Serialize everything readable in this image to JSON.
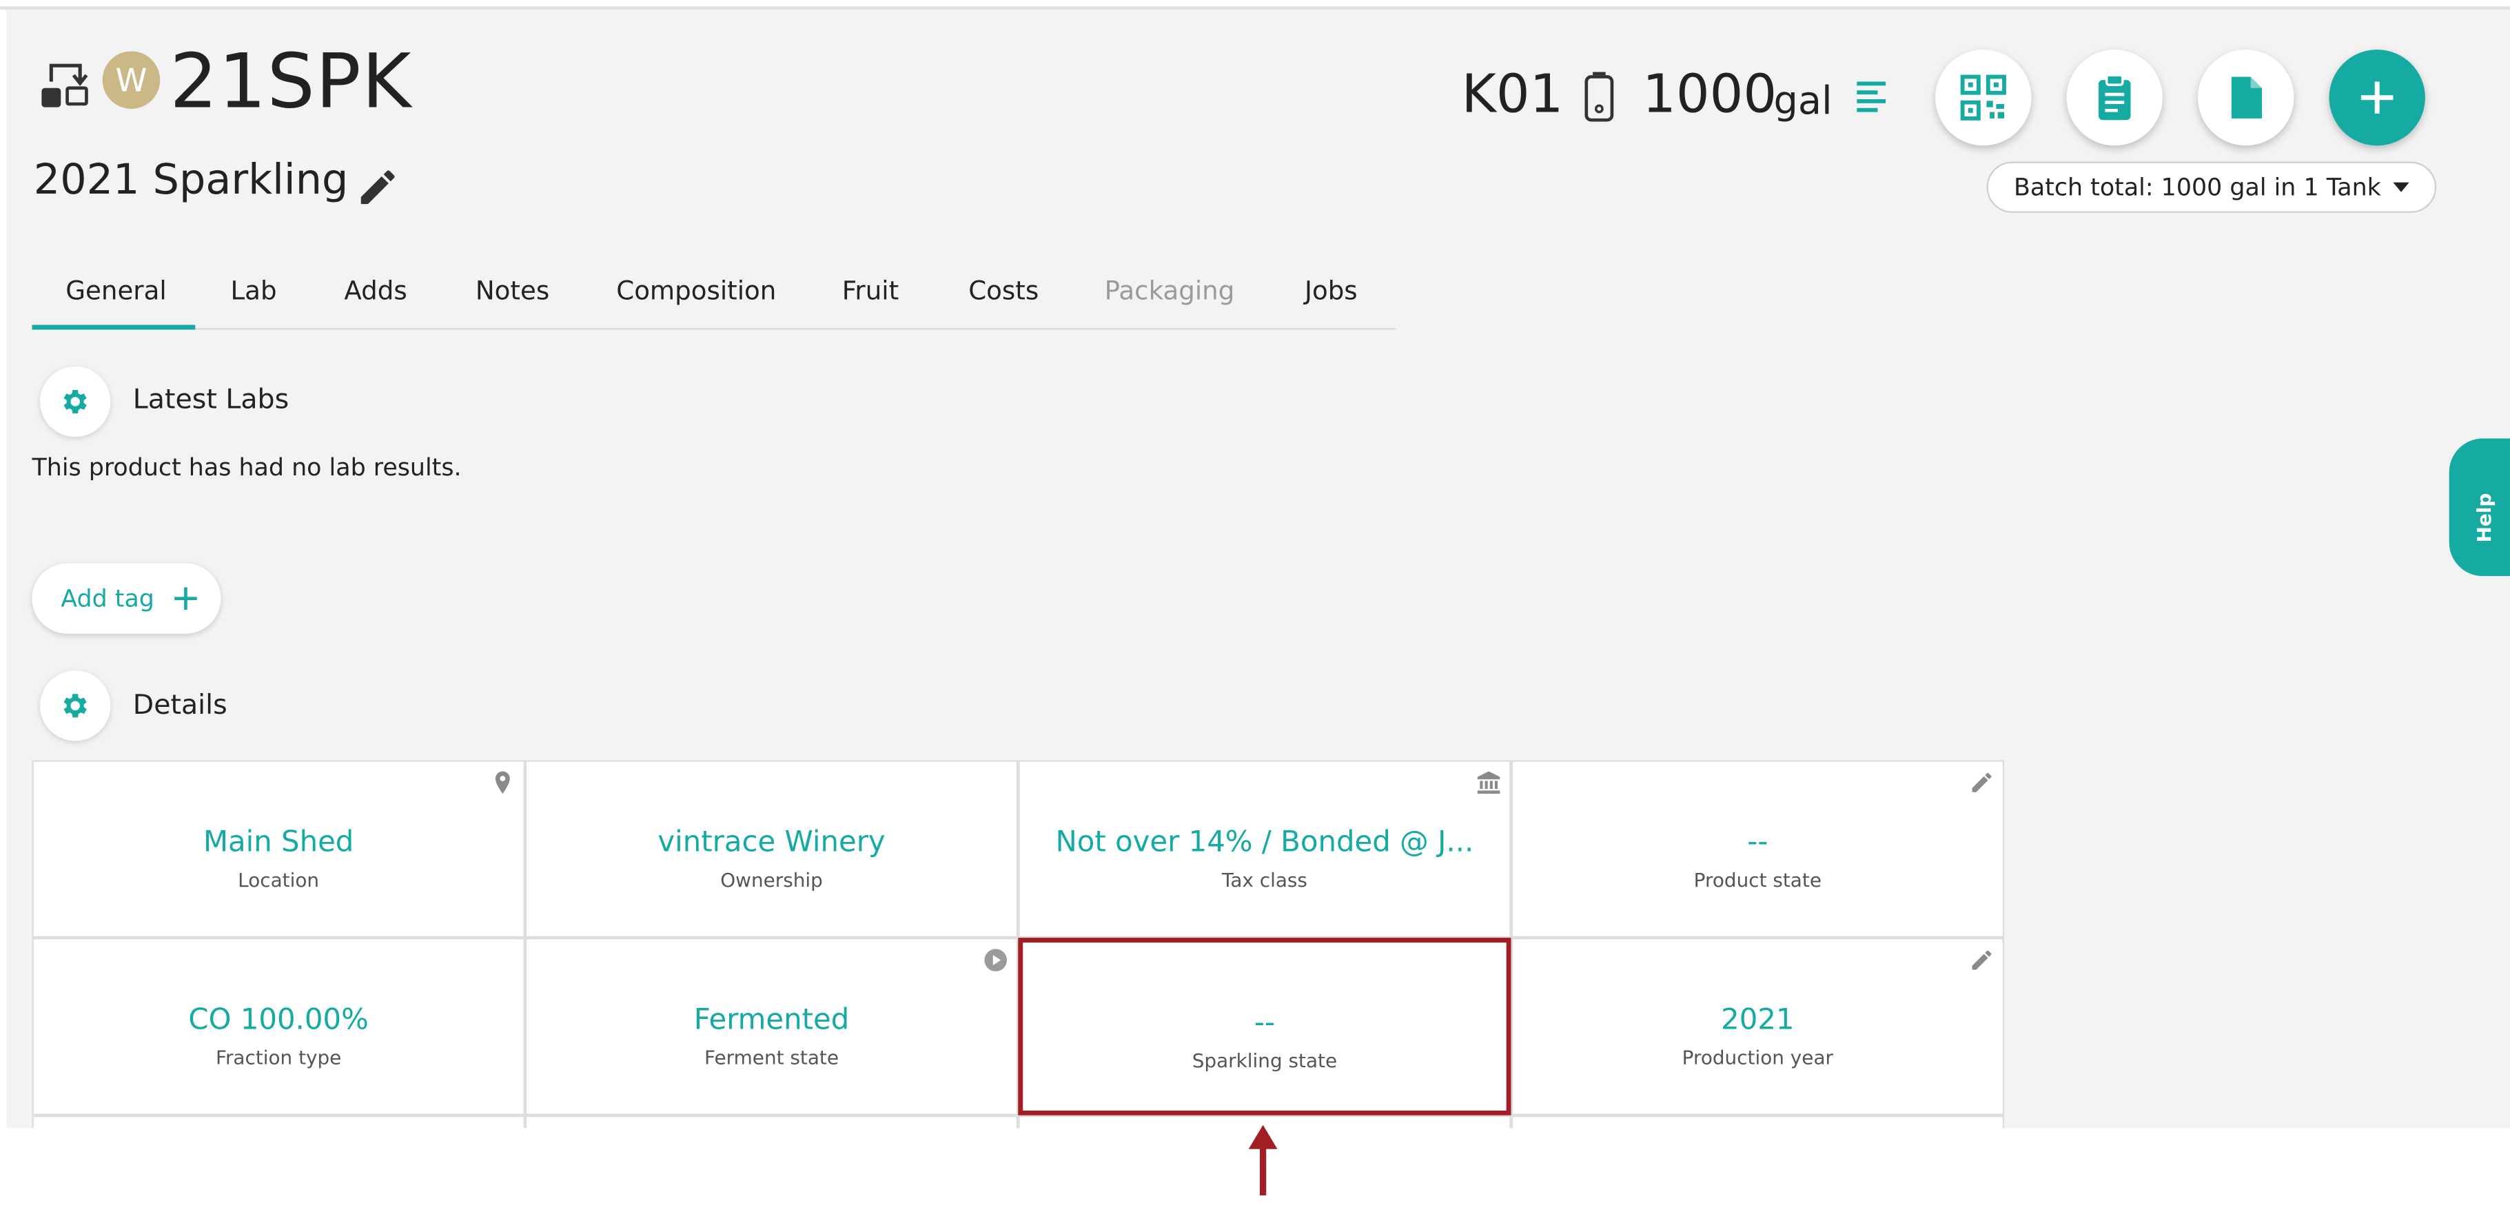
{
  "header": {
    "owner_initial": "W",
    "batch_code": "21SPK",
    "batch_name": "2021 Sparkling",
    "vessel": "K01",
    "volume": "1000",
    "volume_unit": "gal",
    "batch_total": "Batch total: 1000 gal in 1 Tank"
  },
  "tabs": [
    {
      "label": "General",
      "active": true
    },
    {
      "label": "Lab"
    },
    {
      "label": "Adds"
    },
    {
      "label": "Notes"
    },
    {
      "label": "Composition"
    },
    {
      "label": "Fruit"
    },
    {
      "label": "Costs"
    },
    {
      "label": "Packaging",
      "disabled": true
    },
    {
      "label": "Jobs"
    }
  ],
  "latest_labs": {
    "title": "Latest Labs",
    "empty_text": "This product has had no lab results."
  },
  "tags": {
    "add_label": "Add tag"
  },
  "details": {
    "title": "Details",
    "fields": [
      {
        "value": "Main Shed",
        "label": "Location",
        "icon": "location-pin-icon"
      },
      {
        "value": "vintrace Winery",
        "label": "Ownership"
      },
      {
        "value": "Not over 14% / Bonded @ J...",
        "label": "Tax class",
        "icon": "bank-icon"
      },
      {
        "value": "--",
        "label": "Product state",
        "icon": "pencil-icon"
      },
      {
        "value": "CO 100.00%",
        "label": "Fraction type"
      },
      {
        "value": "Fermented",
        "label": "Ferment state",
        "icon": "play-circle-icon"
      },
      {
        "value": "--",
        "label": "Sparkling state",
        "highlighted": true
      },
      {
        "value": "2021",
        "label": "Production year",
        "icon": "pencil-icon"
      }
    ]
  },
  "help": {
    "label": "Help"
  },
  "colors": {
    "accent": "#15aaa2",
    "highlight": "#a21d24",
    "background": "#f3f3f3",
    "owner_badge": "#cbb887"
  }
}
